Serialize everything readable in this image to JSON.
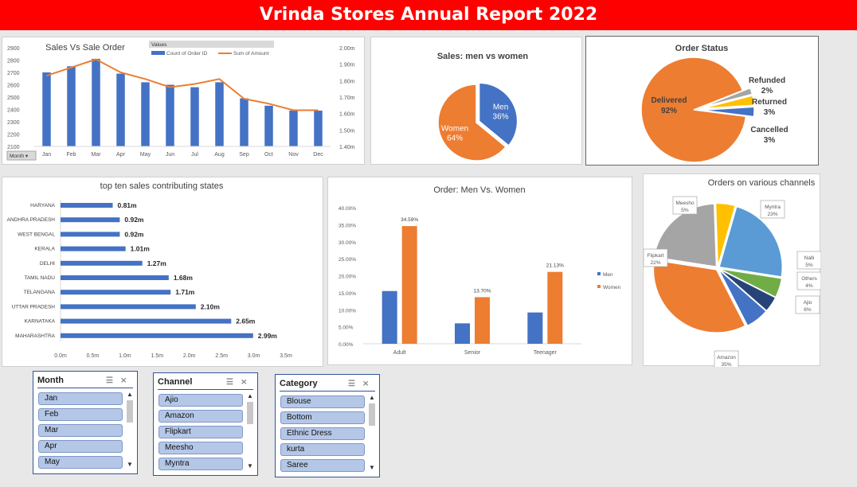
{
  "title": "Vrinda Stores Annual Report 2022",
  "colors": {
    "blue": "#4472c4",
    "orange": "#ed7d31",
    "gray": "#a5a5a5",
    "yellow": "#ffc000",
    "green": "#70ad47",
    "navy": "#264478",
    "banner": "#ff0000"
  },
  "chart_data": [
    {
      "type": "bar",
      "title": "Sales Vs Sale Order",
      "legend_title": "Values",
      "categories": [
        "Jan",
        "Feb",
        "Mar",
        "Apr",
        "May",
        "Jun",
        "Jul",
        "Aug",
        "Sep",
        "Oct",
        "Nov",
        "Dec"
      ],
      "series": [
        {
          "name": "Count of Order ID",
          "kind": "bar",
          "axis": "left",
          "values": [
            2700,
            2750,
            2810,
            2690,
            2620,
            2600,
            2580,
            2620,
            2490,
            2430,
            2390,
            2390
          ]
        },
        {
          "name": "Sum of Amount",
          "kind": "line",
          "axis": "right",
          "values": [
            1.83,
            1.88,
            1.93,
            1.85,
            1.81,
            1.76,
            1.78,
            1.81,
            1.69,
            1.66,
            1.62,
            1.62
          ]
        }
      ],
      "ylim": [
        2100,
        2900
      ],
      "y_ticks": [
        "2900",
        "2800",
        "2700",
        "2600",
        "2500",
        "2400",
        "2300",
        "2200",
        "2100"
      ],
      "y2lim": [
        1.4,
        2.0
      ],
      "y2_ticks": [
        "2.00m",
        "1.90m",
        "1.80m",
        "1.70m",
        "1.60m",
        "1.50m",
        "1.40m"
      ],
      "filter_button": "Month"
    },
    {
      "type": "pie",
      "title": "Sales: men vs women",
      "slices": [
        {
          "label": "Men",
          "pct_label": "36%",
          "value": 36
        },
        {
          "label": "Women",
          "pct_label": "64%",
          "value": 64
        }
      ]
    },
    {
      "type": "pie",
      "title": "Order Status",
      "slices": [
        {
          "label": "Delivered",
          "pct_label": "92%",
          "value": 92
        },
        {
          "label": "Refunded",
          "pct_label": "2%",
          "value": 2
        },
        {
          "label": "Returned",
          "pct_label": "3%",
          "value": 3
        },
        {
          "label": "Cancelled",
          "pct_label": "3%",
          "value": 3
        }
      ]
    },
    {
      "type": "bar",
      "orientation": "horizontal",
      "title": "top ten sales contributing states",
      "categories": [
        "HARYANA",
        "ANDHRA PRADESH",
        "WEST BENGAL",
        "KERALA",
        "DELHI",
        "TAMIL NADU",
        "TELANGANA",
        "UTTAR PRADESH",
        "KARNATAKA",
        "MAHARASHTRA"
      ],
      "values": [
        0.81,
        0.92,
        0.92,
        1.01,
        1.27,
        1.68,
        1.71,
        2.1,
        2.65,
        2.99
      ],
      "value_labels": [
        "0.81m",
        "0.92m",
        "0.92m",
        "1.01m",
        "1.27m",
        "1.68m",
        "1.71m",
        "2.10m",
        "2.65m",
        "2.99m"
      ],
      "xlim": [
        0,
        3.5
      ],
      "x_ticks": [
        "0.0m",
        "0.5m",
        "1.0m",
        "1.5m",
        "2.0m",
        "2.5m",
        "3.0m",
        "3.5m"
      ]
    },
    {
      "type": "bar",
      "title": "Order: Men Vs. Women",
      "categories": [
        "Adult",
        "Senior",
        "Teenager"
      ],
      "series": [
        {
          "name": "Men",
          "values": [
            15.5,
            6.0,
            9.2
          ]
        },
        {
          "name": "Women",
          "values": [
            34.59,
            13.7,
            21.13
          ],
          "value_labels": [
            "34.59%",
            "13.70%",
            "21.13%"
          ]
        }
      ],
      "ylim": [
        0,
        40
      ],
      "y_ticks": [
        "40.00%",
        "35.00%",
        "30.00%",
        "25.00%",
        "20.00%",
        "15.00%",
        "10.00%",
        "5.00%",
        "0.00%"
      ]
    },
    {
      "type": "pie",
      "title": "Orders on various channels",
      "slices": [
        {
          "label": "Myntra",
          "pct_label": "23%",
          "value": 23
        },
        {
          "label": "Nalli",
          "pct_label": "5%",
          "value": 5
        },
        {
          "label": "Others",
          "pct_label": "4%",
          "value": 4
        },
        {
          "label": "Ajio",
          "pct_label": "6%",
          "value": 6
        },
        {
          "label": "Amazon",
          "pct_label": "35%",
          "value": 35
        },
        {
          "label": "Flipkart",
          "pct_label": "22%",
          "value": 22
        },
        {
          "label": "Meesho",
          "pct_label": "5%",
          "value": 5
        }
      ]
    }
  ],
  "slicers": [
    {
      "title": "Month",
      "items": [
        "Jan",
        "Feb",
        "Mar",
        "Apr",
        "May"
      ]
    },
    {
      "title": "Channel",
      "items": [
        "Ajio",
        "Amazon",
        "Flipkart",
        "Meesho",
        "Myntra"
      ]
    },
    {
      "title": "Category",
      "items": [
        "Blouse",
        "Bottom",
        "Ethnic Dress",
        "kurta",
        "Saree"
      ]
    }
  ]
}
